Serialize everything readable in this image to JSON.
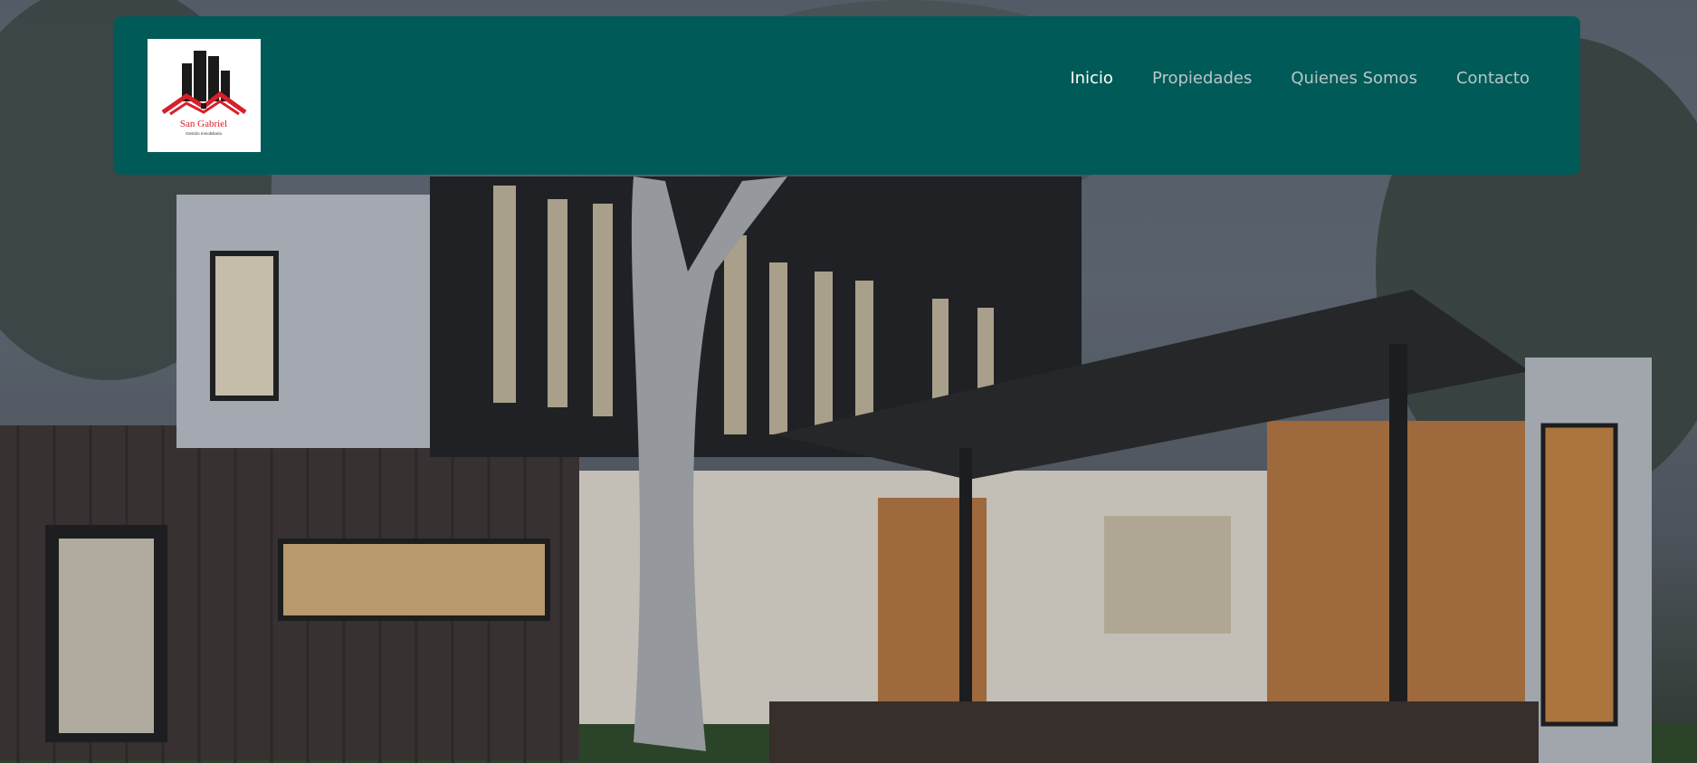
{
  "brand": {
    "name": "San Gabriel",
    "tagline": "Gestión Inmobiliaria"
  },
  "nav": {
    "items": [
      {
        "label": "Inicio",
        "active": true
      },
      {
        "label": "Propiedades",
        "active": false
      },
      {
        "label": "Quienes Somos",
        "active": false
      },
      {
        "label": "Contacto",
        "active": false
      }
    ]
  },
  "colors": {
    "navbar_bg": "#005b58",
    "nav_active": "#ffffff",
    "nav_inactive": "#b8c7c6",
    "logo_red": "#d6202a"
  },
  "hero": {
    "image": "modern-house-photo"
  }
}
